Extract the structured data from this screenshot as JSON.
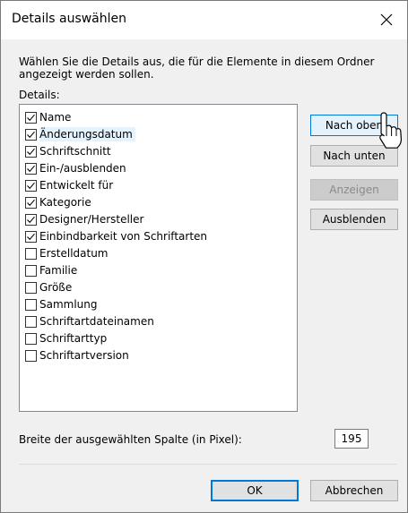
{
  "window": {
    "title": "Details auswählen"
  },
  "description": "Wählen Sie die Details aus, die für die Elemente in diesem Ordner angezeigt werden sollen.",
  "details_label": "Details:",
  "details": [
    {
      "label": "Name",
      "checked": true
    },
    {
      "label": "Änderungsdatum",
      "checked": true,
      "hover": true
    },
    {
      "label": "Schriftschnitt",
      "checked": true
    },
    {
      "label": "Ein-/ausblenden",
      "checked": true
    },
    {
      "label": "Entwickelt für",
      "checked": true
    },
    {
      "label": "Kategorie",
      "checked": true
    },
    {
      "label": "Designer/Hersteller",
      "checked": true
    },
    {
      "label": "Einbindbarkeit von Schriftarten",
      "checked": true
    },
    {
      "label": "Erstelldatum",
      "checked": false
    },
    {
      "label": "Familie",
      "checked": false
    },
    {
      "label": "Größe",
      "checked": false
    },
    {
      "label": "Sammlung",
      "checked": false
    },
    {
      "label": "Schriftartdateinamen",
      "checked": false
    },
    {
      "label": "Schriftarttyp",
      "checked": false
    },
    {
      "label": "Schriftartversion",
      "checked": false
    }
  ],
  "buttons": {
    "move_up": "Nach oben",
    "move_down": "Nach unten",
    "show": "Anzeigen",
    "hide": "Ausblenden",
    "ok": "OK",
    "cancel": "Abbrechen"
  },
  "width": {
    "label": "Breite der ausgewählten Spalte (in Pixel):",
    "value": "195"
  },
  "icons": {
    "close": "close-icon",
    "check": "check-icon",
    "cursor": "hand-cursor-icon"
  }
}
